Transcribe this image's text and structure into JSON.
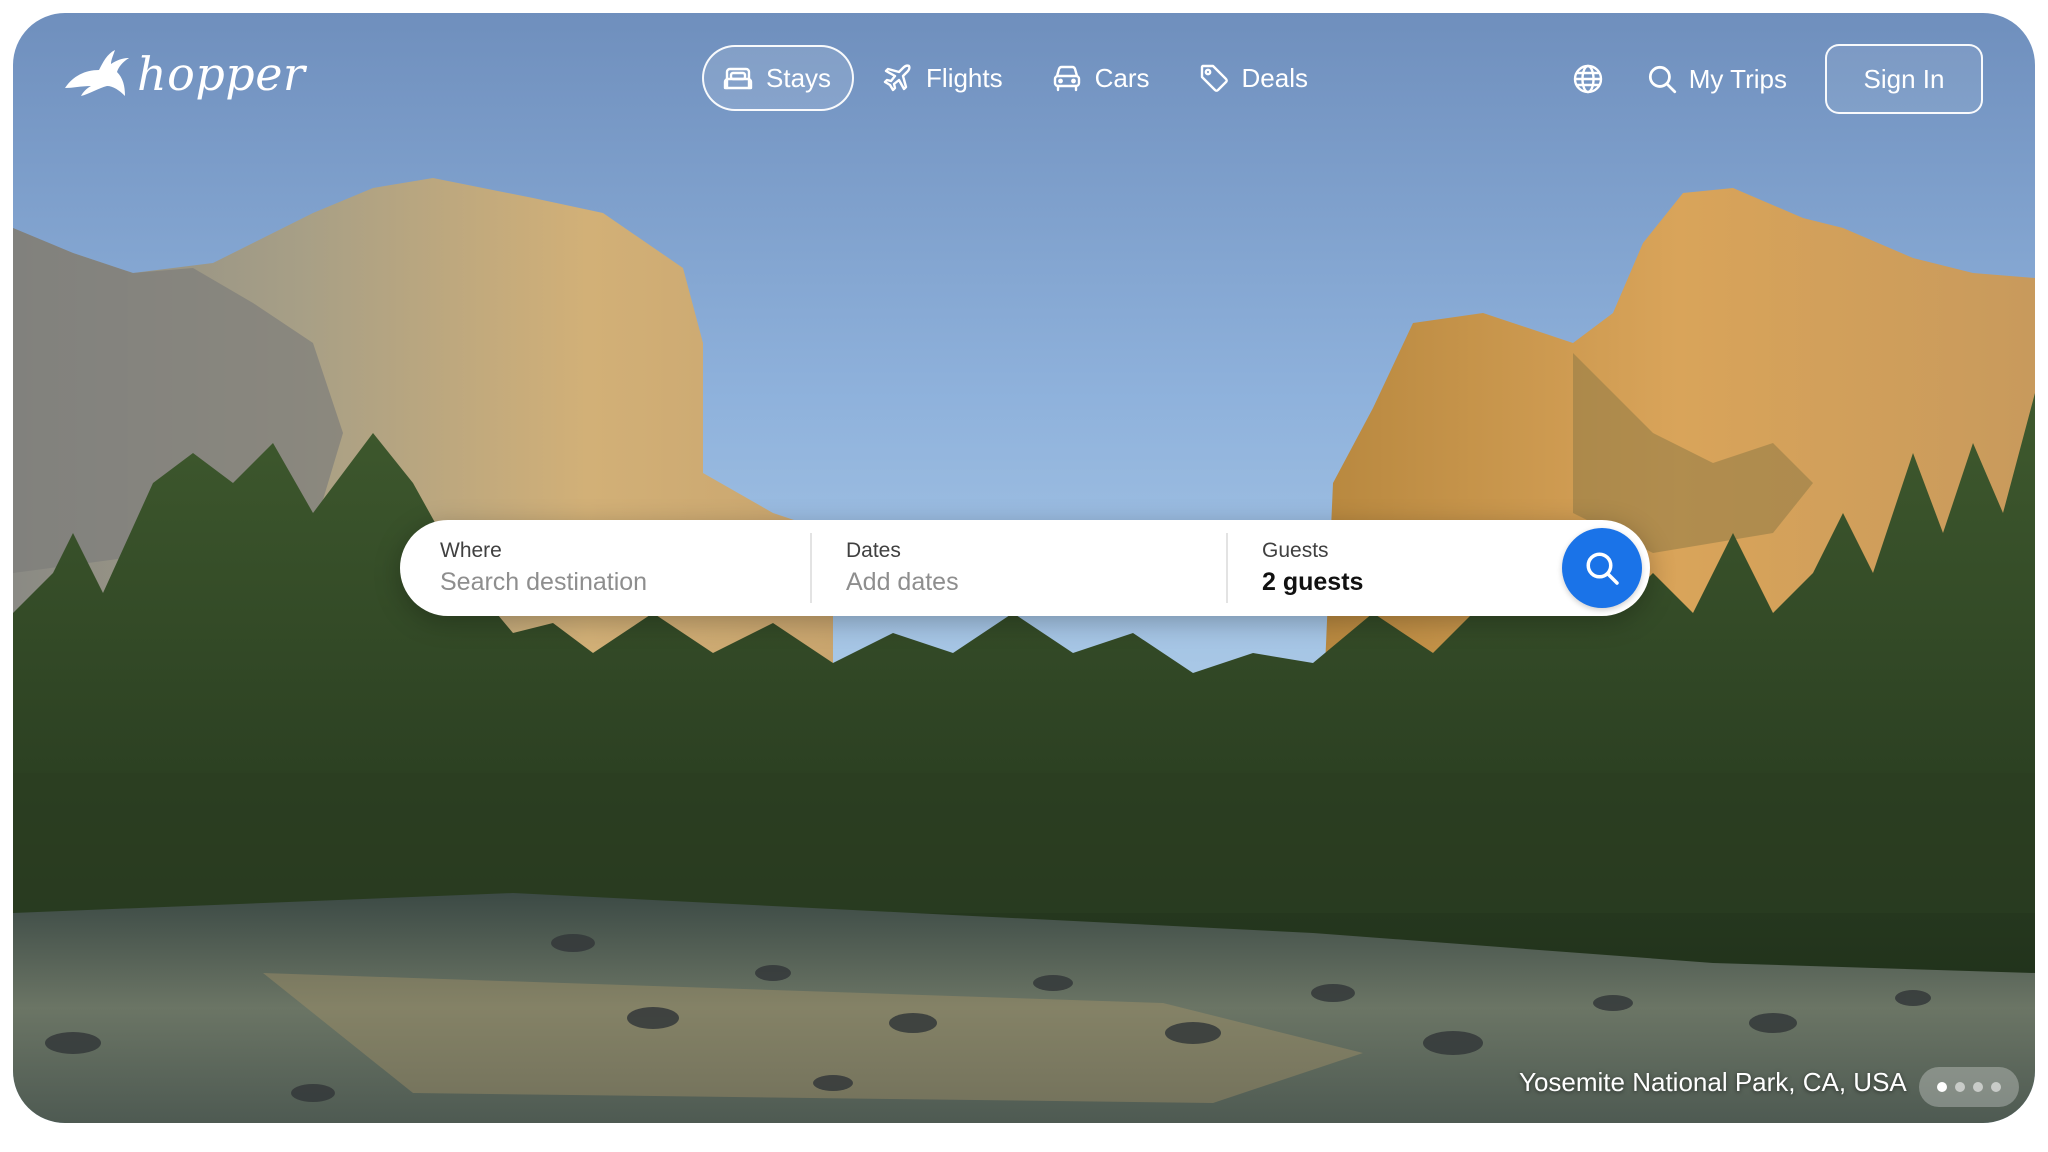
{
  "brand": {
    "name": "hopper",
    "icon": "bunny-logo-icon"
  },
  "nav": {
    "tabs": [
      {
        "label": "Stays",
        "icon": "bed-icon",
        "active": true
      },
      {
        "label": "Flights",
        "icon": "airplane-icon",
        "active": false
      },
      {
        "label": "Cars",
        "icon": "car-icon",
        "active": false
      },
      {
        "label": "Deals",
        "icon": "tag-icon",
        "active": false
      }
    ],
    "language_icon": "globe-icon",
    "my_trips": {
      "label": "My Trips",
      "icon": "search-icon"
    },
    "sign_in": "Sign In"
  },
  "search": {
    "where": {
      "label": "Where",
      "placeholder": "Search destination"
    },
    "dates": {
      "label": "Dates",
      "placeholder": "Add dates"
    },
    "guests": {
      "label": "Guests",
      "value": "2 guests"
    },
    "button_icon": "search-icon"
  },
  "hero": {
    "location": "Yosemite National Park, CA, USA",
    "carousel": {
      "total": 4,
      "active": 1
    }
  },
  "colors": {
    "accent": "#1a73e8",
    "nav_text": "#ffffff"
  }
}
